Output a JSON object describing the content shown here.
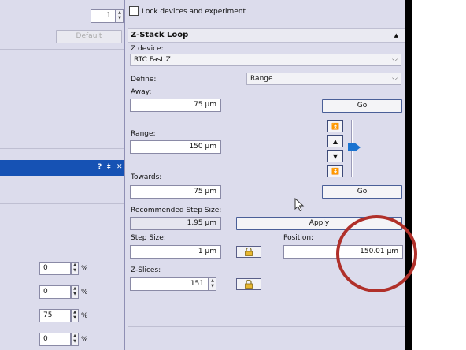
{
  "left": {
    "top_spin_value": "1",
    "default_label": "Default",
    "titlebar_icons": [
      "?",
      "‡",
      "✕"
    ],
    "rows": [
      {
        "value": "0",
        "unit": "%"
      },
      {
        "value": "0",
        "unit": "%"
      },
      {
        "value": "75",
        "unit": "%"
      },
      {
        "value": "0",
        "unit": "%"
      }
    ]
  },
  "lock_checkbox_label": "Lock devices and experiment",
  "section": {
    "title": "Z-Stack Loop",
    "collapse_glyph": "▲"
  },
  "zdevice": {
    "label": "Z device:",
    "value": "RTC Fast Z"
  },
  "define": {
    "label": "Define:",
    "value": "Range"
  },
  "away": {
    "label": "Away:",
    "value": "75 µm",
    "go": "Go"
  },
  "range": {
    "label": "Range:",
    "value": "150 µm"
  },
  "towards": {
    "label": "Towards:",
    "value": "75 µm",
    "go": "Go"
  },
  "recommended": {
    "label": "Recommended Step Size:",
    "value": "1.95 µm",
    "apply": "Apply"
  },
  "step": {
    "label": "Step Size:",
    "value": "1 µm"
  },
  "position": {
    "label": "Position:",
    "value": "150.01 µm"
  },
  "zslices": {
    "label": "Z-Slices:",
    "value": "151"
  },
  "move_buttons": [
    "⏫",
    "▲",
    "▼",
    "⏬"
  ],
  "colors": {
    "annotation_circle": "#b0302a",
    "slider_thumb": "#1a73d0",
    "titlebar": "#1652b4"
  },
  "icons": [
    "lock-icon",
    "cursor-icon",
    "dropdown-arrow-icon"
  ]
}
